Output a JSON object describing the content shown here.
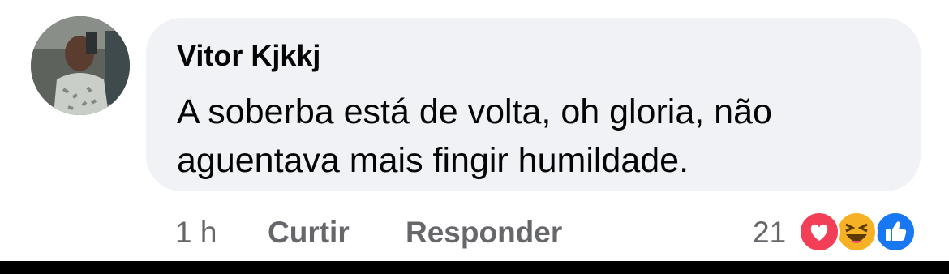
{
  "comment": {
    "author": "Vitor Kjkkj",
    "text_line1": "A soberba está de volta, oh gloria, não",
    "text_line2": "aguentava mais fingir humildade."
  },
  "actions": {
    "time": "1 h",
    "like_label": "Curtir",
    "reply_label": "Responder"
  },
  "reactions": {
    "count": "21",
    "types": [
      "love-icon",
      "haha-icon",
      "like-icon"
    ]
  },
  "colors": {
    "bubble": "#f0f2f5",
    "meta_text": "#65676b",
    "love": "#f33e58",
    "haha": "#f7b125",
    "like": "#1877f2"
  }
}
